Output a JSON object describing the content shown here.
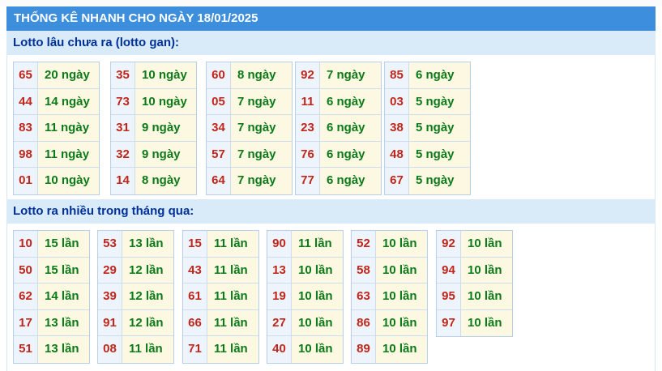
{
  "header": {
    "title": "THỐNG KÊ NHANH CHO NGÀY 18/01/2025"
  },
  "section_gan": {
    "title": "Lotto lâu chưa ra (lotto gan):",
    "groups": [
      [
        {
          "num": "65",
          "val": "20 ngày"
        },
        {
          "num": "44",
          "val": "14 ngày"
        },
        {
          "num": "83",
          "val": "11 ngày"
        },
        {
          "num": "98",
          "val": "11 ngày"
        },
        {
          "num": "01",
          "val": "10 ngày"
        }
      ],
      [
        {
          "num": "35",
          "val": "10 ngày"
        },
        {
          "num": "73",
          "val": "10 ngày"
        },
        {
          "num": "31",
          "val": "9 ngày"
        },
        {
          "num": "32",
          "val": "9 ngày"
        },
        {
          "num": "14",
          "val": "8 ngày"
        }
      ],
      [
        {
          "num": "60",
          "val": "8 ngày"
        },
        {
          "num": "05",
          "val": "7 ngày"
        },
        {
          "num": "34",
          "val": "7 ngày"
        },
        {
          "num": "57",
          "val": "7 ngày"
        },
        {
          "num": "64",
          "val": "7 ngày"
        }
      ],
      [
        {
          "num": "92",
          "val": "7 ngày"
        },
        {
          "num": "11",
          "val": "6 ngày"
        },
        {
          "num": "23",
          "val": "6 ngày"
        },
        {
          "num": "76",
          "val": "6 ngày"
        },
        {
          "num": "77",
          "val": "6 ngày"
        }
      ],
      [
        {
          "num": "85",
          "val": "6 ngày"
        },
        {
          "num": "03",
          "val": "5 ngày"
        },
        {
          "num": "38",
          "val": "5 ngày"
        },
        {
          "num": "48",
          "val": "5 ngày"
        },
        {
          "num": "67",
          "val": "5 ngày"
        }
      ]
    ]
  },
  "section_many": {
    "title": "Lotto ra nhiều trong tháng qua:",
    "groups": [
      [
        {
          "num": "10",
          "val": "15 lần"
        },
        {
          "num": "50",
          "val": "15 lần"
        },
        {
          "num": "62",
          "val": "14 lần"
        },
        {
          "num": "17",
          "val": "13 lần"
        },
        {
          "num": "51",
          "val": "13 lần"
        }
      ],
      [
        {
          "num": "53",
          "val": "13 lần"
        },
        {
          "num": "29",
          "val": "12 lần"
        },
        {
          "num": "39",
          "val": "12 lần"
        },
        {
          "num": "91",
          "val": "12 lần"
        },
        {
          "num": "08",
          "val": "11 lần"
        }
      ],
      [
        {
          "num": "15",
          "val": "11 lần"
        },
        {
          "num": "43",
          "val": "11 lần"
        },
        {
          "num": "61",
          "val": "11 lần"
        },
        {
          "num": "66",
          "val": "11 lần"
        },
        {
          "num": "71",
          "val": "11 lần"
        }
      ],
      [
        {
          "num": "90",
          "val": "11 lần"
        },
        {
          "num": "13",
          "val": "10 lần"
        },
        {
          "num": "19",
          "val": "10 lần"
        },
        {
          "num": "27",
          "val": "10 lần"
        },
        {
          "num": "40",
          "val": "10 lần"
        }
      ],
      [
        {
          "num": "52",
          "val": "10 lần"
        },
        {
          "num": "58",
          "val": "10 lần"
        },
        {
          "num": "63",
          "val": "10 lần"
        },
        {
          "num": "86",
          "val": "10 lần"
        },
        {
          "num": "89",
          "val": "10 lần"
        }
      ],
      [
        {
          "num": "92",
          "val": "10 lần"
        },
        {
          "num": "94",
          "val": "10 lần"
        },
        {
          "num": "95",
          "val": "10 lần"
        },
        {
          "num": "97",
          "val": "10 lần"
        }
      ]
    ]
  }
}
